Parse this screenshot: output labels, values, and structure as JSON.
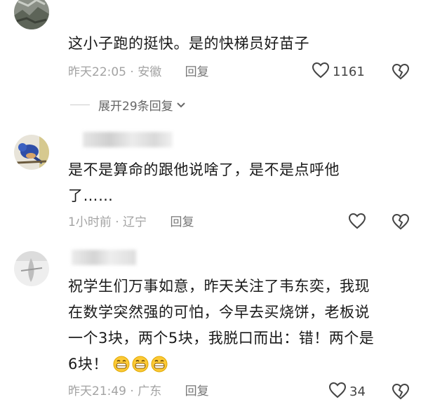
{
  "comments": [
    {
      "text": "这小子跑的挺快。是的快梯员好苗子",
      "time": "昨天22:05",
      "location": "安徽",
      "reply_label": "回复",
      "likes": "1161",
      "expand_label": "展开29条回复"
    },
    {
      "text_line1": "是不是算命的跟他说啥了，是不是点呼他",
      "text_line2": "了……",
      "time": "1小时前",
      "location": "辽宁",
      "reply_label": "回复"
    },
    {
      "text_line1": "祝学生们万事如意，昨天关注了韦东奕，我现",
      "text_line2": "在数学突然强的可怕，今早去买烧饼，老板说",
      "text_line3": "一个3块，两个5块，我脱口而出：错！两个是",
      "text_line4": "6块！",
      "time": "昨天21:49",
      "location": "广东",
      "reply_label": "回复",
      "likes": "34"
    }
  ],
  "separator": "·",
  "colors": {
    "text": "#1a1a1a",
    "meta": "#a3a3a3",
    "reply": "#777777"
  }
}
